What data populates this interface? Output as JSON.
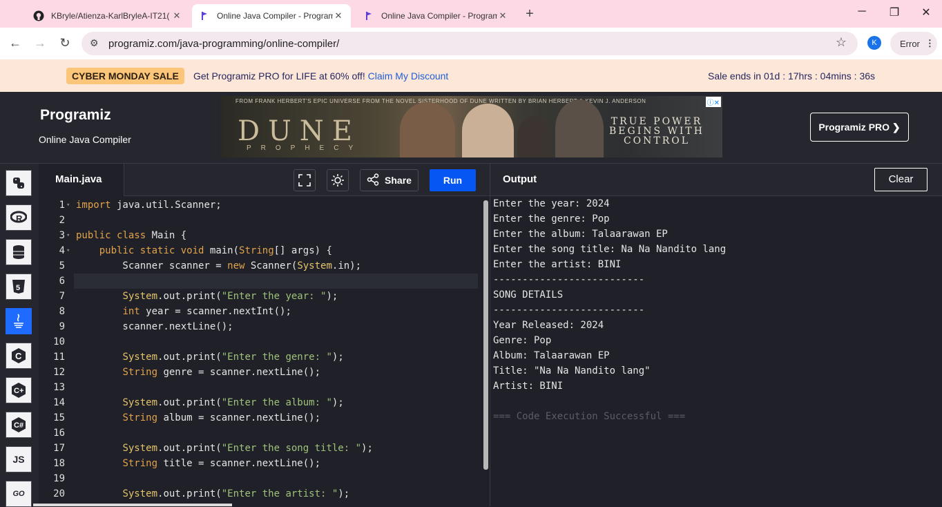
{
  "browser": {
    "tabs": [
      {
        "title": "KBryle/Atienza-KarlBryleA-IT21(",
        "icon": "github-icon"
      },
      {
        "title": "Online Java Compiler - Program",
        "icon": "programiz-icon"
      },
      {
        "title": "Online Java Compiler - Program",
        "icon": "programiz-icon"
      }
    ],
    "new_tab": "+",
    "url": "programiz.com/java-programming/online-compiler/",
    "avatar": "K",
    "error_label": "Error"
  },
  "sale": {
    "badge": "CYBER MONDAY SALE",
    "text": "Get Programiz PRO for LIFE at 60% off!",
    "link": "Claim My Discount",
    "ends": "Sale ends in 01d : 17hrs : 04mins : 36s"
  },
  "header": {
    "logo": "Programiz",
    "subtitle": "Online Java Compiler",
    "pro_button": "Programiz PRO ❯",
    "ad": {
      "top_text": "FROM FRANK HERBERT'S EPIC UNIVERSE FROM THE NOVEL SISTERHOOD OF DUNE WRITTEN BY BRIAN HERBERT & KEVIN J. ANDERSON",
      "title": "DUNE",
      "subtitle": "PROPHECY",
      "tagline": "TRUE POWER BEGINS WITH CONTROL"
    }
  },
  "rail": [
    "python-icon",
    "r-icon",
    "database-icon",
    "html5-icon",
    "java-icon",
    "c-icon",
    "cpp-icon",
    "csharp-icon",
    "JS",
    "GO"
  ],
  "editor": {
    "filename": "Main.java",
    "share_label": "Share",
    "run_label": "Run"
  },
  "code_lines": [
    "import java.util.Scanner;",
    "",
    "public class Main {",
    "    public static void main(String[] args) {",
    "        Scanner scanner = new Scanner(System.in);",
    "",
    "        System.out.print(\"Enter the year: \");",
    "        int year = scanner.nextInt();",
    "        scanner.nextLine();",
    "",
    "        System.out.print(\"Enter the genre: \");",
    "        String genre = scanner.nextLine();",
    "",
    "        System.out.print(\"Enter the album: \");",
    "        String album = scanner.nextLine();",
    "",
    "        System.out.print(\"Enter the song title: \");",
    "        String title = scanner.nextLine();",
    "",
    "        System.out.print(\"Enter the artist: \");"
  ],
  "output": {
    "title": "Output",
    "clear_label": "Clear",
    "lines": [
      "Enter the year: 2024",
      "Enter the genre: Pop",
      "Enter the album: Talaarawan EP",
      "Enter the song title: Na Na Nandito lang",
      "Enter the artist: BINI",
      "--------------------------",
      "SONG DETAILS",
      "--------------------------",
      "Year Released: 2024",
      "Genre: Pop",
      "Album: Talaarawan EP",
      "Title: \"Na Na Nandito lang\"",
      "Artist: BINI",
      "",
      "=== Code Execution Successful ==="
    ]
  }
}
